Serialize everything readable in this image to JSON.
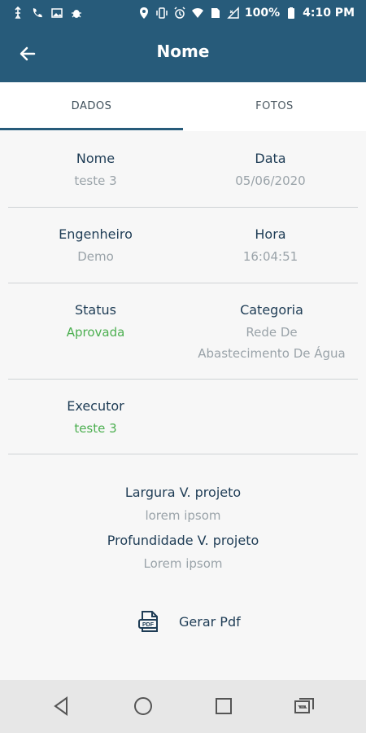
{
  "status_bar": {
    "battery_percent": "100%",
    "time": "4:10 PM"
  },
  "appbar": {
    "title": "Nome"
  },
  "tabs": [
    {
      "label": "DADOS",
      "selected": true
    },
    {
      "label": "FOTOS",
      "selected": false
    }
  ],
  "details": {
    "nome_label": "Nome",
    "nome_value": "teste 3",
    "data_label": "Data",
    "data_value": "05/06/2020",
    "engenheiro_label": "Engenheiro",
    "engenheiro_value": "Demo",
    "hora_label": "Hora",
    "hora_value": "16:04:51",
    "status_label": "Status",
    "status_value": "Aprovada",
    "categoria_label": "Categoria",
    "categoria_value_line1": "Rede De",
    "categoria_value_line2": "Abastecimento De Água",
    "executor_label": "Executor",
    "executor_value": "teste 3",
    "largura_label": "Largura V. projeto",
    "largura_value": "lorem ipsom",
    "profundidade_label": "Profundidade V. projeto",
    "profundidade_value": "Lorem ipsom"
  },
  "actions": {
    "gerar_pdf_label": "Gerar Pdf"
  },
  "colors": {
    "primary": "#275b7a",
    "label": "#1e3c55",
    "muted": "#9aa3a9",
    "success": "#4caf50",
    "background": "#f7f7f7",
    "nav_background": "#e7e7e7"
  },
  "icons": {
    "back": "arrow-left-icon",
    "pdf": "pdf-file-icon",
    "nav_back": "nav-back-icon",
    "nav_home": "nav-home-icon",
    "nav_recent": "nav-recent-icon",
    "nav_switch": "nav-switch-icon"
  }
}
